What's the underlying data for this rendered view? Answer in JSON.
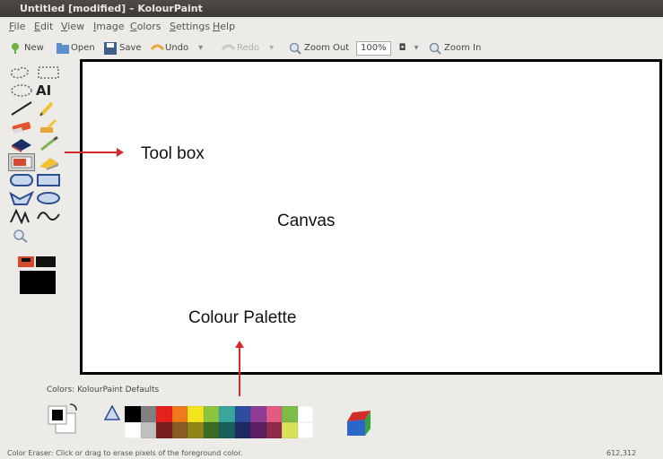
{
  "window": {
    "title": "Untitled [modified] – KolourPaint"
  },
  "menu": [
    "File",
    "Edit",
    "View",
    "Image",
    "Colors",
    "Settings",
    "Help"
  ],
  "toolbar": {
    "new": "New",
    "open": "Open",
    "save": "Save",
    "undo": "Undo",
    "redo": "Redo",
    "zoom_out": "Zoom Out",
    "zoom_value": "100%",
    "zoom_in": "Zoom In"
  },
  "annotations": {
    "toolbox": "Tool box",
    "canvas": "Canvas",
    "palette": "Colour Palette"
  },
  "palette": {
    "label": "Colors: KolourPaint Defaults",
    "top_row": [
      "#000000",
      "#808080",
      "#e42320",
      "#f07a1b",
      "#f2e51c",
      "#8cc43f",
      "#3aa59a",
      "#2c4c9e",
      "#8e3d97",
      "#e25b83",
      "#7dbb4b",
      "#ffffff"
    ],
    "bottom_row": [
      "#ffffff",
      "#c0c0c0",
      "#7a1f1f",
      "#8a5b24",
      "#8e8716",
      "#3c6b24",
      "#1a5f5b",
      "#1f2a63",
      "#5b2164",
      "#8f2b4c",
      "#d7e25a",
      "#ffffff"
    ]
  },
  "status": {
    "text": "Color Eraser: Click or drag to erase pixels of the foreground color.",
    "coords": "612,312"
  },
  "colors": {
    "annotation_arrow": "#d32a2a",
    "canvas_border": "#000000",
    "title_bar": "#3f3d38"
  }
}
